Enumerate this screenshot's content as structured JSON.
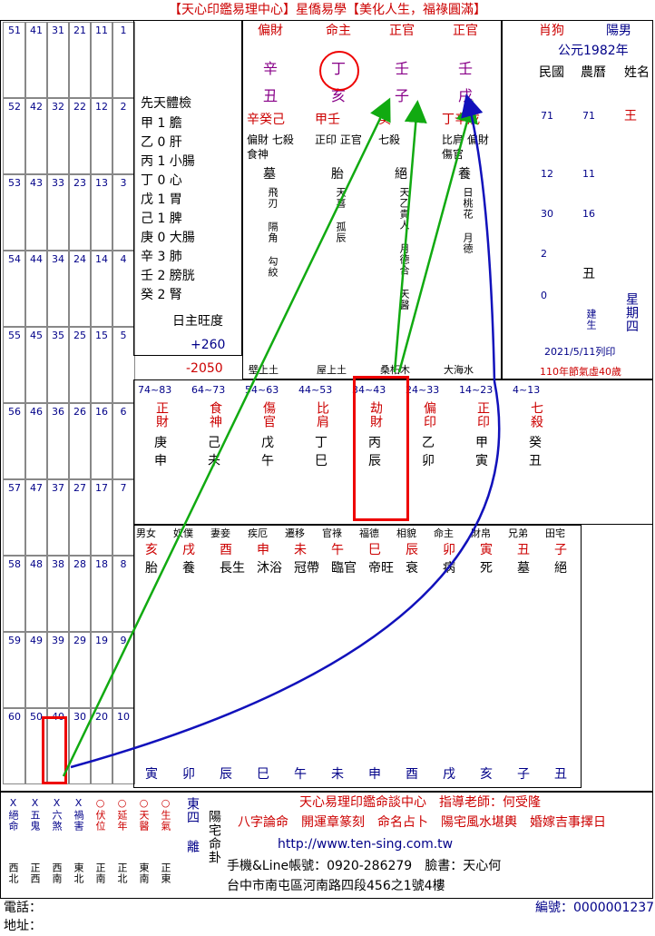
{
  "header": {
    "title": "【天心印鑑易理中心】星僑易學【美化人生，福祿圓滿】"
  },
  "info": {
    "zodiac": "肖狗",
    "gender": "陽男",
    "year": "公元1982年",
    "cal1": "民國",
    "cal2": "農曆",
    "name_label": "姓名",
    "name": "王",
    "roc_year": "71",
    "lunar_year": "71",
    "roc_month": "12",
    "lunar_month": "11",
    "roc_day": "30",
    "lunar_day": "16",
    "roc_hour": "2",
    "lunar_hour_stem": "丑",
    "min": "0",
    "weekday_label": "星期四",
    "built": "建生",
    "date": "2021/5/11列印",
    "age": "110年節氣虛40歲"
  },
  "pillars": {
    "headers": [
      "偏財",
      "命主",
      "正官",
      "正官"
    ],
    "stems": [
      "辛",
      "丁",
      "壬",
      "壬"
    ],
    "branches": [
      "丑",
      "亥",
      "子",
      "戌"
    ]
  },
  "hidden": [
    "辛癸己",
    "甲壬",
    "癸",
    "丁辛戊"
  ],
  "hidden_gods": [
    "偏財 七殺 食神",
    "正印 正官",
    "七殺",
    "比肩 偏財 傷官"
  ],
  "stages": [
    "墓",
    "胎",
    "絕",
    "養"
  ],
  "spirits": [
    "飛刃 隔角 勾絞",
    "天喜 孤辰",
    "天乙貴人 月德合 天醫",
    "日桃花 月德"
  ],
  "na_yin": [
    "壁上土",
    "屋上土",
    "桑柘木",
    "大海水"
  ],
  "body_check": {
    "title": "先天體檢",
    "items": [
      "甲 1 膽",
      "乙 0 肝",
      "丙 1 小腸",
      "丁 0 心",
      "戊 1 胃",
      "己 1 脾",
      "庚 0 大腸",
      "辛 3 肺",
      "壬 2 膀胱",
      "癸 2 腎"
    ]
  },
  "strength": {
    "title": "日主旺度",
    "v1": "+260",
    "v2": "-2050"
  },
  "luck": {
    "ages": [
      "74~83",
      "64~73",
      "54~63",
      "44~53",
      "34~43",
      "24~33",
      "14~23",
      "4~13"
    ],
    "gods": [
      "正財",
      "食神",
      "傷官",
      "比肩",
      "劫財",
      "偏印",
      "正印",
      "七殺"
    ],
    "stems": [
      "庚",
      "己",
      "戊",
      "丁",
      "丙",
      "乙",
      "甲",
      "癸"
    ],
    "branches": [
      "申",
      "未",
      "午",
      "巳",
      "辰",
      "卯",
      "寅",
      "丑"
    ]
  },
  "palaces": {
    "names": [
      "男女",
      "奴僕",
      "妻妾",
      "疾厄",
      "遷移",
      "官祿",
      "福德",
      "相貌",
      "命主",
      "財帛",
      "兄弟",
      "田宅"
    ],
    "branches": [
      "亥",
      "戌",
      "酉",
      "申",
      "未",
      "午",
      "巳",
      "辰",
      "卯",
      "寅",
      "丑",
      "子"
    ],
    "states": [
      "胎",
      "養",
      "長生",
      "沐浴",
      "冠帶",
      "臨官",
      "帝旺",
      "衰",
      "病",
      "死",
      "墓",
      "絕"
    ]
  },
  "bottom_branches": [
    "寅",
    "卯",
    "辰",
    "巳",
    "午",
    "未",
    "申",
    "酉",
    "戌",
    "亥",
    "子",
    "丑"
  ],
  "footer": {
    "center": "天心易理印鑑命談中心　指導老師：何受隆",
    "services": "八字論命　開運章篆刻　命名占卜　陽宅風水堪輿　婚嫁吉事擇日",
    "url": "http://www.ten-sing.com.tw",
    "phone": "手機&Line帳號：0920-286279　臉書：天心何",
    "address": "台中市南屯區河南路四段456之1號4樓",
    "tel_label": "電話：",
    "addr_label": "地址：",
    "serial": "編號：0000001237"
  },
  "house": {
    "label": "陽宅命卦",
    "dirs": [
      "X絕命",
      "X五鬼",
      "X六煞",
      "X禍害",
      "○伏位",
      "○延年",
      "○天醫",
      "○生氣"
    ],
    "dir2": [
      "西北",
      "正西",
      "西南",
      "東北",
      "正南",
      "正北",
      "東南",
      "正東"
    ],
    "gua": "東四 離"
  }
}
